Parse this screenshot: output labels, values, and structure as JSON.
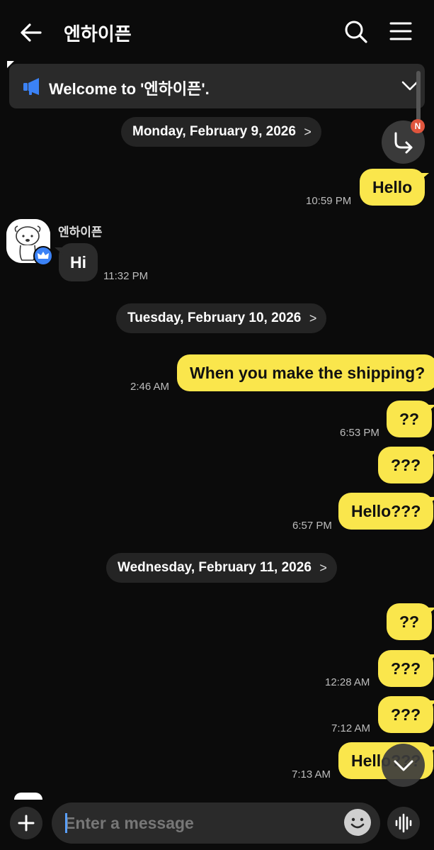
{
  "header": {
    "title": "엔하이픈",
    "back_icon": "arrow-left-icon",
    "search_icon": "search-icon",
    "menu_icon": "hamburger-menu-icon"
  },
  "notice": {
    "text": "Welcome to '엔하이픈'.",
    "icon": "megaphone-icon"
  },
  "share_badge": "N",
  "dates": [
    "Monday, February 9, 2026",
    "Tuesday, February 10, 2026",
    "Wednesday, February 11, 2026"
  ],
  "messages": [
    {
      "from": "me",
      "text": "Hello",
      "time": "10:59 PM"
    },
    {
      "from": "other",
      "sender": "엔하이픈",
      "text": "Hi",
      "time": "11:32 PM"
    },
    {
      "from": "me",
      "text": "When you make the shipping?",
      "time": "2:46 AM"
    },
    {
      "from": "me",
      "text": "??",
      "time": "6:53 PM"
    },
    {
      "from": "me",
      "text": "???",
      "time": ""
    },
    {
      "from": "me",
      "text": "Hello???",
      "time": "6:57 PM"
    },
    {
      "from": "me",
      "text": "??",
      "time": ""
    },
    {
      "from": "me",
      "text": "???",
      "time": "12:28 AM"
    },
    {
      "from": "me",
      "text": "???",
      "time": "7:12 AM"
    },
    {
      "from": "me",
      "text": "Hello???",
      "time": "7:13 AM"
    }
  ],
  "input": {
    "placeholder": "Enter a message"
  },
  "colors": {
    "background": "#0b0b0b",
    "my_bubble": "#fae64c",
    "other_bubble": "#2b2b2b",
    "date_pill": "#242424",
    "accent_blue": "#3b82f6"
  }
}
